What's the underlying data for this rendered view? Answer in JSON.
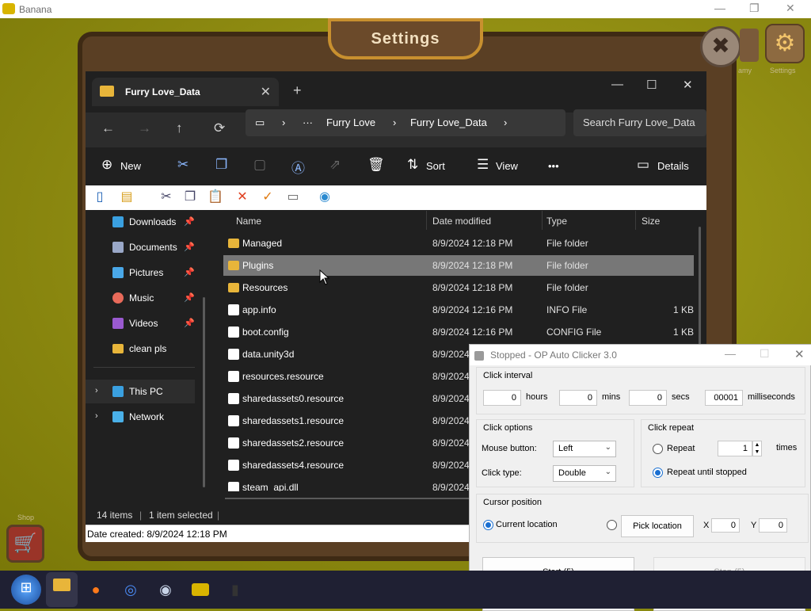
{
  "app_window": {
    "title": "Banana",
    "minimize": "—",
    "maximize": "❐",
    "close": "✕"
  },
  "game": {
    "settings_title": "Settings",
    "close_icon": "✖",
    "gear_icon": "⚙",
    "side_label_1": "amy",
    "side_label_2": "Settings",
    "shop_label": "Shop",
    "shop_icon": "🛒"
  },
  "explorer": {
    "tab_title": "Furry Love_Data",
    "tab_close": "✕",
    "new_tab": "+",
    "window_controls": {
      "min": "—",
      "max": "☐",
      "close": "✕"
    },
    "nav": {
      "back": "←",
      "forward": "→",
      "up": "↑",
      "refresh": "⟳"
    },
    "address": {
      "pc_icon": "▭",
      "sep": "›",
      "more": "···",
      "crumb1": "Furry Love",
      "crumb2": "Furry Love_Data"
    },
    "search_placeholder": "Search Furry Love_Data",
    "commands": {
      "new": "New",
      "sort": "Sort",
      "view": "View",
      "more": "•••",
      "details": "Details"
    },
    "nav_pane": [
      {
        "label": "Downloads",
        "pinned": true,
        "color": "#3aa0e0"
      },
      {
        "label": "Documents",
        "pinned": true,
        "color": "#9aa8c8"
      },
      {
        "label": "Pictures",
        "pinned": true,
        "color": "#4aa8e8"
      },
      {
        "label": "Music",
        "pinned": true,
        "color": "#e86a5a"
      },
      {
        "label": "Videos",
        "pinned": true,
        "color": "#9a5ad0"
      },
      {
        "label": "clean pls",
        "pinned": false,
        "color": "#e8b53a"
      },
      {
        "label": "This PC",
        "pinned": false,
        "color": "#3aa0e0"
      },
      {
        "label": "Network",
        "pinned": false,
        "color": "#4ab0e8"
      }
    ],
    "columns": {
      "name": "Name",
      "date": "Date modified",
      "type": "Type",
      "size": "Size"
    },
    "files": [
      {
        "name": "Managed",
        "date": "8/9/2024 12:18 PM",
        "type": "File folder",
        "size": "",
        "kind": "folder"
      },
      {
        "name": "Plugins",
        "date": "8/9/2024 12:18 PM",
        "type": "File folder",
        "size": "",
        "kind": "folder",
        "selected": true
      },
      {
        "name": "Resources",
        "date": "8/9/2024 12:18 PM",
        "type": "File folder",
        "size": "",
        "kind": "folder"
      },
      {
        "name": "app.info",
        "date": "8/9/2024 12:16 PM",
        "type": "INFO File",
        "size": "1 KB",
        "kind": "file"
      },
      {
        "name": "boot.config",
        "date": "8/9/2024 12:16 PM",
        "type": "CONFIG File",
        "size": "1 KB",
        "kind": "file"
      },
      {
        "name": "data.unity3d",
        "date": "8/9/2024",
        "type": "",
        "size": "",
        "kind": "file"
      },
      {
        "name": "resources.resource",
        "date": "8/9/2024",
        "type": "",
        "size": "",
        "kind": "file"
      },
      {
        "name": "sharedassets0.resource",
        "date": "8/9/2024",
        "type": "",
        "size": "",
        "kind": "file"
      },
      {
        "name": "sharedassets1.resource",
        "date": "8/9/2024",
        "type": "",
        "size": "",
        "kind": "file"
      },
      {
        "name": "sharedassets2.resource",
        "date": "8/9/2024",
        "type": "",
        "size": "",
        "kind": "file"
      },
      {
        "name": "sharedassets4.resource",
        "date": "8/9/2024",
        "type": "",
        "size": "",
        "kind": "file"
      },
      {
        "name": "steam_api.dll",
        "date": "8/9/2024",
        "type": "",
        "size": "",
        "kind": "file"
      }
    ],
    "status": {
      "items": "14 items",
      "selected": "1 item selected"
    },
    "date_created": "Date created: 8/9/2024 12:18 PM"
  },
  "clicker": {
    "title": "Stopped - OP Auto Clicker 3.0",
    "click_interval_label": "Click interval",
    "hours_value": "0",
    "hours_label": "hours",
    "mins_value": "0",
    "mins_label": "mins",
    "secs_value": "0",
    "secs_label": "secs",
    "ms_value": "00001",
    "ms_label": "milliseconds",
    "click_options_label": "Click options",
    "mouse_button_label": "Mouse button:",
    "mouse_button_value": "Left",
    "click_type_label": "Click type:",
    "click_type_value": "Double",
    "click_repeat_label": "Click repeat",
    "repeat_label": "Repeat",
    "repeat_value": "1",
    "times_label": "times",
    "repeat_until_label": "Repeat until stopped",
    "cursor_position_label": "Cursor position",
    "current_location_label": "Current location",
    "pick_location_label": "Pick location",
    "x_label": "X",
    "x_value": "0",
    "y_label": "Y",
    "y_value": "0",
    "start_label": "Start (5)",
    "stop_label": "Stop (5)"
  },
  "taskbar": {
    "start_icon": "⊞",
    "apps": [
      "file-explorer",
      "firefox",
      "chrome",
      "steam",
      "banana",
      "app"
    ]
  }
}
